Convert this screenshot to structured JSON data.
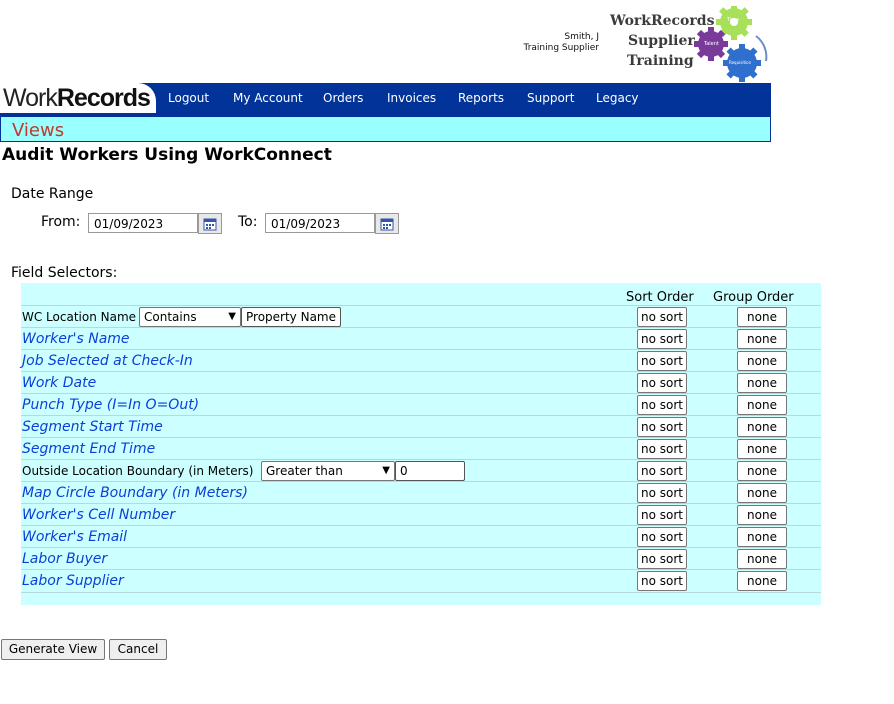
{
  "user": {
    "name": "Smith, J",
    "org": "Training Supplier"
  },
  "brand": {
    "line1": "WorkRecords",
    "line2": "Supplier",
    "line3": "Training",
    "gear_labels": [
      "Time",
      "Talent",
      "Requisition"
    ]
  },
  "logo": {
    "part1": "Work",
    "part2": "Records"
  },
  "nav": [
    {
      "label": "Logout"
    },
    {
      "label": "My Account"
    },
    {
      "label": "Orders"
    },
    {
      "label": "Invoices"
    },
    {
      "label": "Reports"
    },
    {
      "label": "Support"
    },
    {
      "label": "Legacy"
    }
  ],
  "views_title": "Views",
  "page_title": "Audit Workers Using WorkConnect",
  "date_range": {
    "label": "Date Range",
    "from_label": "From:",
    "from_value": "01/09/2023",
    "to_label": "To:",
    "to_value": "01/09/2023"
  },
  "field_selectors": {
    "label": "Field Selectors:",
    "sort_header": "Sort Order",
    "group_header": "Group Order",
    "rows": [
      {
        "label": "WC Location Name",
        "operator": "Contains",
        "value": "Property Name",
        "sort": "no sort",
        "group": "none"
      },
      {
        "label": "Worker's Name",
        "sort": "no sort",
        "group": "none"
      },
      {
        "label": "Job Selected at Check-In",
        "sort": "no sort",
        "group": "none"
      },
      {
        "label": "Work Date",
        "sort": "no sort",
        "group": "none"
      },
      {
        "label": "Punch Type (I=In O=Out)",
        "sort": "no sort",
        "group": "none"
      },
      {
        "label": "Segment Start Time",
        "sort": "no sort",
        "group": "none"
      },
      {
        "label": "Segment End Time",
        "sort": "no sort",
        "group": "none"
      },
      {
        "label": "Outside Location Boundary (in Meters)",
        "operator": "Greater than",
        "value": "0",
        "sort": "no sort",
        "group": "none"
      },
      {
        "label": "Map Circle Boundary (in Meters)",
        "sort": "no sort",
        "group": "none"
      },
      {
        "label": "Worker's Cell Number",
        "sort": "no sort",
        "group": "none"
      },
      {
        "label": "Worker's Email",
        "sort": "no sort",
        "group": "none"
      },
      {
        "label": "Labor Buyer",
        "sort": "no sort",
        "group": "none"
      },
      {
        "label": "Labor Supplier",
        "sort": "no sort",
        "group": "none"
      }
    ]
  },
  "actions": {
    "generate": "Generate View",
    "cancel": "Cancel"
  },
  "colors": {
    "nav_bg": "#023399",
    "views_bg": "#99ffff",
    "panel_bg": "#ccffff",
    "link_text": "#0b3fd6",
    "views_title": "#c0392b"
  }
}
